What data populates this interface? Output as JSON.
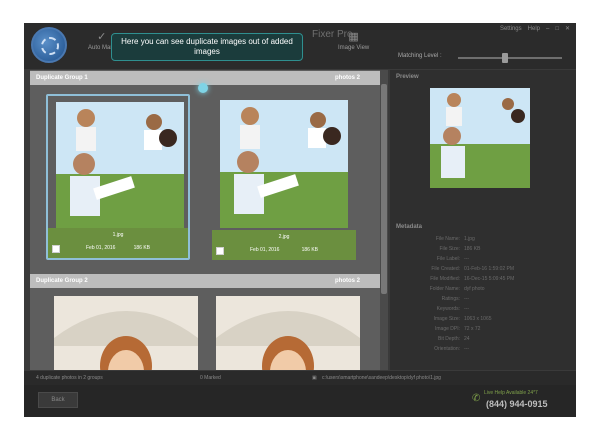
{
  "app": {
    "name": "Fixer Pro"
  },
  "toolbar": {
    "auto_mark_label": "Auto Mark",
    "image_view_label": "Image View",
    "top_right": [
      "Settings",
      "Help"
    ],
    "matching_level_label": "Matching Level :"
  },
  "tooltip": {
    "text": "Here you can see duplicate images out of added images"
  },
  "groups": [
    {
      "title": "Duplicate Group 1",
      "count": "photos 2",
      "cards": [
        {
          "file": "1.jpg",
          "date": "Feb 01, 2016",
          "size": "186 KB",
          "selected": true
        },
        {
          "file": "2.jpg",
          "date": "Feb 01, 2016",
          "size": "186 KB",
          "selected": false
        }
      ]
    },
    {
      "title": "Duplicate Group 2",
      "count": "photos 2",
      "cards": [
        {},
        {}
      ]
    }
  ],
  "right_pane": {
    "preview_title": "Preview",
    "metadata_title": "Metadata",
    "metadata": [
      {
        "k": "File Name:",
        "v": "1.jpg"
      },
      {
        "k": "File Size:",
        "v": "186 KB"
      },
      {
        "k": "File Label:",
        "v": "---"
      },
      {
        "k": "File Created:",
        "v": "01-Feb-16 1:59:02 PM"
      },
      {
        "k": "File Modified:",
        "v": "16-Dec-15 5:09:45 PM"
      },
      {
        "k": "Folder Name:",
        "v": "dyf photo"
      },
      {
        "k": "Ratings:",
        "v": "---"
      },
      {
        "k": "Keywords:",
        "v": "---"
      },
      {
        "k": "Image Size:",
        "v": "1063 x 1065"
      },
      {
        "k": "Image DPI:",
        "v": "72 x 72"
      },
      {
        "k": "Bit Depth:",
        "v": "24"
      },
      {
        "k": "Orientation:",
        "v": "---"
      }
    ]
  },
  "status": {
    "left": "4 duplicate photos in 2 groups",
    "mid": "0 Marked",
    "path": "c:\\users\\smartphone\\sandeep\\desktop\\dyf photo\\1.jpg"
  },
  "footer": {
    "back_label": "Back",
    "help_line": "Live Help Available 24*7",
    "phone": "(844) 944-0915"
  },
  "colors": {
    "tooltip_border": "#2f8f8f",
    "group_meta_bg": "#6b8f3f"
  }
}
